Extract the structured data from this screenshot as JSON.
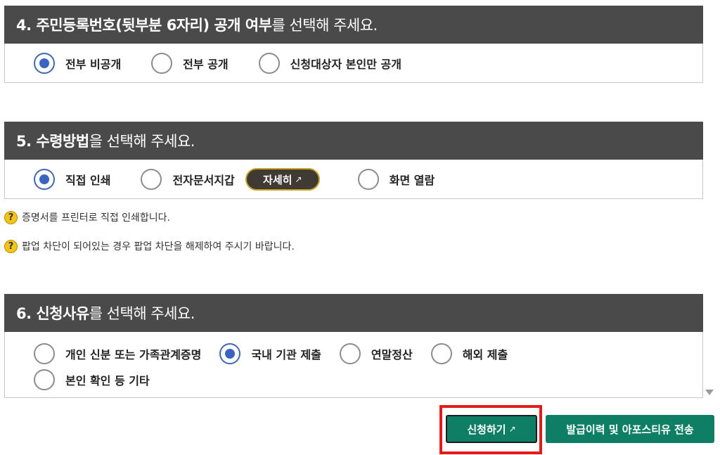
{
  "section4": {
    "title_bold": "4. 주민등록번호(뒷부분 6자리) 공개 여부",
    "title_rest": "를 선택해 주세요.",
    "options": [
      {
        "label": "전부 비공개",
        "checked": true
      },
      {
        "label": "전부 공개",
        "checked": false
      },
      {
        "label": "신청대상자 본인만 공개",
        "checked": false
      }
    ]
  },
  "section5": {
    "title_bold": "5. 수령방법",
    "title_rest": "을 선택해 주세요.",
    "options": [
      {
        "label": "직접 인쇄",
        "checked": true
      },
      {
        "label": "전자문서지갑",
        "checked": false
      },
      {
        "label": "화면 열람",
        "checked": false
      }
    ],
    "detail_label": "자세히",
    "help": [
      "증명서를 프린터로 직접 인쇄합니다.",
      "팝업 차단이 되어있는 경우 팝업 차단을 해제하여 주시기 바랍니다."
    ],
    "help_icon_glyph": "?"
  },
  "section6": {
    "title_bold": "6. 신청사유",
    "title_rest": "를 선택해 주세요.",
    "options": [
      {
        "label": "개인 신분 또는 가족관계증명",
        "checked": false
      },
      {
        "label": "국내 기관 제출",
        "checked": true
      },
      {
        "label": "연말정산",
        "checked": false
      },
      {
        "label": "해외 제출",
        "checked": false
      },
      {
        "label": "본인 확인 등 기타",
        "checked": false
      }
    ]
  },
  "actions": {
    "submit_label": "신청하기",
    "history_label": "발급이력 및 아포스티유 전송"
  },
  "icons": {
    "external_link": "external-link-icon",
    "help": "question-circle-icon",
    "scroll_down": "triangle-down-icon"
  },
  "colors": {
    "header_bg": "#4a4a4a",
    "radio_accent": "#3a64c0",
    "button_green": "#0e7f64",
    "highlight_red": "#e31b1b",
    "detail_border": "#c9a227"
  }
}
